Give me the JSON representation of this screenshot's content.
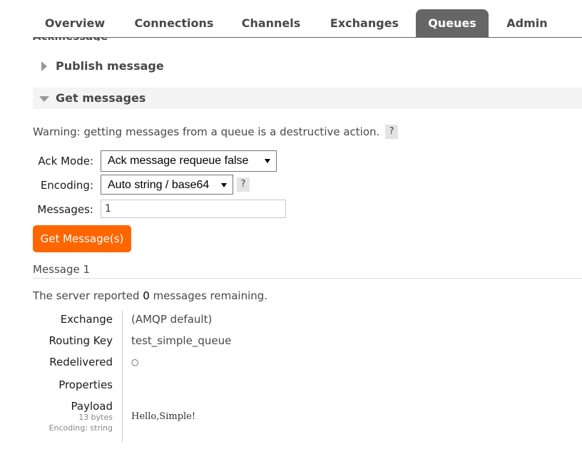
{
  "nav": {
    "tabs": [
      {
        "label": "Overview",
        "active": false
      },
      {
        "label": "Connections",
        "active": false
      },
      {
        "label": "Channels",
        "active": false
      },
      {
        "label": "Exchanges",
        "active": false
      },
      {
        "label": "Queues",
        "active": true
      },
      {
        "label": "Admin",
        "active": false
      }
    ]
  },
  "sections": {
    "publish": {
      "label": "Publish message",
      "expanded": false
    },
    "get": {
      "label": "Get messages",
      "expanded": true
    }
  },
  "get_form": {
    "warning": "Warning: getting messages from a queue is a destructive action.",
    "help_label": "?",
    "ack_mode_label": "Ack Mode:",
    "ack_mode_value": "Ack message requeue false",
    "encoding_label": "Encoding:",
    "encoding_value": "Auto string / base64",
    "messages_label": "Messages:",
    "messages_value": "1",
    "submit_label": "Get Message(s)"
  },
  "result": {
    "message_heading": "Message 1",
    "remaining_prefix": "The server reported ",
    "remaining_count": "0",
    "remaining_suffix": " messages remaining.",
    "fields": {
      "exchange_label": "Exchange",
      "exchange_value": "(AMQP default)",
      "routing_key_label": "Routing Key",
      "routing_key_value": "test_simple_queue",
      "redelivered_label": "Redelivered",
      "redelivered_value": "○",
      "properties_label": "Properties",
      "payload_label": "Payload",
      "payload_size": "13 bytes",
      "payload_encoding": "Encoding: string",
      "payload_value": "Hello,Simple!"
    }
  },
  "colors": {
    "accent": "#ff6600",
    "active_tab": "#666666",
    "section_bg": "#f4f4f4"
  }
}
